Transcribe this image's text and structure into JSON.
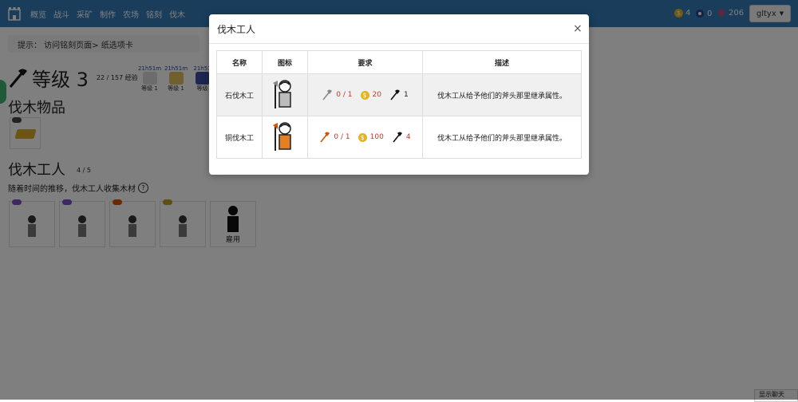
{
  "nav": {
    "items": [
      "概览",
      "战斗",
      "采矿",
      "制作",
      "农场",
      "铭刻",
      "伐木"
    ],
    "gold": "4",
    "blue": "0",
    "gem": "206",
    "user": "gltyx"
  },
  "tip": "提示： 访问铭刻页面> 纸选项卡",
  "level": {
    "title": "等级 3",
    "xp": "22 / 157 经验"
  },
  "badges": [
    {
      "time": "21h51m",
      "label": "等级 1"
    },
    {
      "time": "21h51m",
      "label": "等级 1"
    },
    {
      "time": "21h51",
      "label": "等级"
    }
  ],
  "items_section": {
    "title": "伐木物品"
  },
  "lumberjacks": {
    "title": "伐木工人",
    "count": "4 / 5",
    "desc": "随着时间的推移，伐木工人收集木材",
    "help": "?",
    "hire": "雇用"
  },
  "chat_button": "显示聊天",
  "modal": {
    "title": "伐木工人",
    "close": "×",
    "headers": [
      "名称",
      "图标",
      "要求",
      "描述"
    ],
    "rows": [
      {
        "name": "石伐木工",
        "have": "0 / 1",
        "gold": "20",
        "level": "1",
        "desc": "伐木工从给予他们的斧头那里继承属性。",
        "color": "#888888"
      },
      {
        "name": "铜伐木工",
        "have": "0 / 1",
        "gold": "100",
        "level": "4",
        "desc": "伐木工从给予他们的斧头那里继承属性。",
        "color": "#d35400"
      }
    ]
  },
  "colors": {
    "nav": "#337ab7",
    "gold": "#e3b422",
    "required": "#c0392b"
  }
}
